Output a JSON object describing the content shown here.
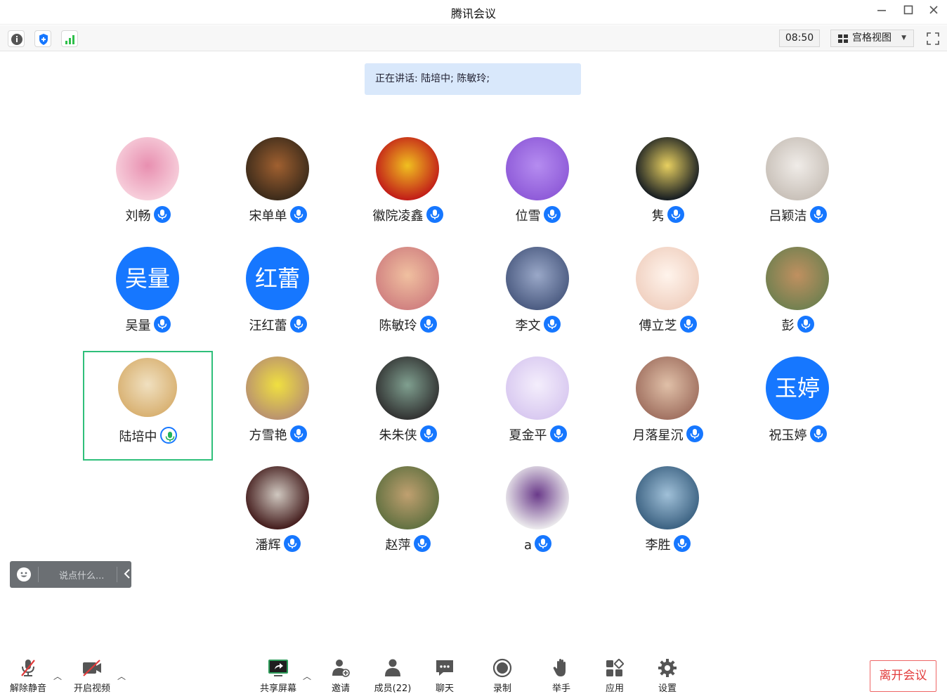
{
  "window": {
    "title": "腾讯会议"
  },
  "toolbar": {
    "timer": "08:50",
    "view_mode": "宫格视图"
  },
  "speaking_banner": "正在讲话: 陆培中; 陈敏玲;",
  "participants": [
    {
      "name": "刘畅",
      "avatar_text": ""
    },
    {
      "name": "宋单单",
      "avatar_text": ""
    },
    {
      "name": "徽院凌鑫",
      "avatar_text": ""
    },
    {
      "name": "位雪",
      "avatar_text": ""
    },
    {
      "name": "隽",
      "avatar_text": ""
    },
    {
      "name": "吕颖洁",
      "avatar_text": ""
    },
    {
      "name": "吴量",
      "avatar_text": "吴量"
    },
    {
      "name": "汪红蕾",
      "avatar_text": "红蕾"
    },
    {
      "name": "陈敏玲",
      "avatar_text": ""
    },
    {
      "name": "李文",
      "avatar_text": ""
    },
    {
      "name": "傅立芝",
      "avatar_text": ""
    },
    {
      "name": "彭",
      "avatar_text": ""
    },
    {
      "name": "陆培中",
      "avatar_text": ""
    },
    {
      "name": "方雪艳",
      "avatar_text": ""
    },
    {
      "name": "朱朱侠",
      "avatar_text": ""
    },
    {
      "name": "夏金平",
      "avatar_text": ""
    },
    {
      "name": "月落星沉",
      "avatar_text": ""
    },
    {
      "name": "祝玉婷",
      "avatar_text": "玉婷"
    },
    {
      "name": "潘辉",
      "avatar_text": ""
    },
    {
      "name": "赵萍",
      "avatar_text": ""
    },
    {
      "name": "a",
      "avatar_text": ""
    },
    {
      "name": "李胜",
      "avatar_text": ""
    }
  ],
  "chat": {
    "placeholder": "说点什么..."
  },
  "bottom": {
    "unmute": "解除静音",
    "start_video": "开启视频",
    "share_screen": "共享屏幕",
    "invite": "邀请",
    "members": "成员(22)",
    "chat": "聊天",
    "record": "录制",
    "raise_hand": "举手",
    "apps": "应用",
    "settings": "设置",
    "leave": "离开会议"
  },
  "colors": {
    "accent": "#1677ff",
    "active_border": "#2fbf7a",
    "banner": "#d9e8fb",
    "leave": "#e23b3b"
  }
}
